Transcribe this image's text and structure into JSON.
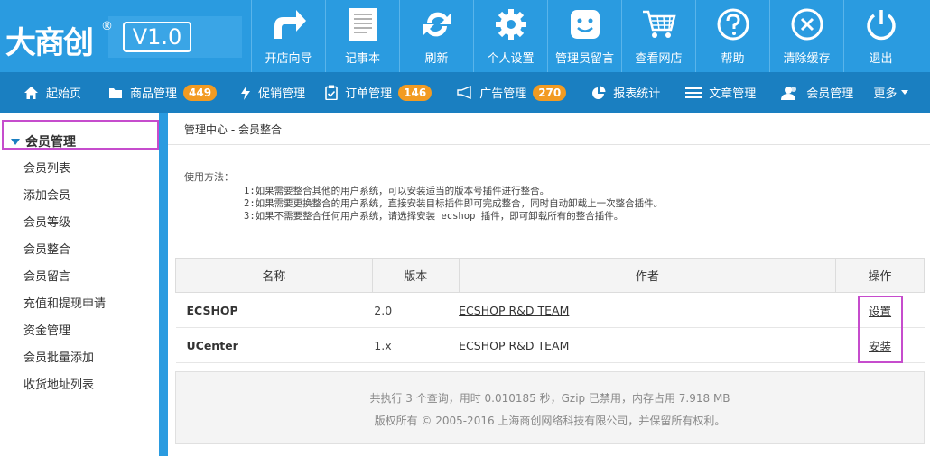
{
  "logo": {
    "brand": "大商创",
    "registered": "®",
    "version": "V1.0"
  },
  "topnav": [
    {
      "label": "开店向导",
      "icon": "redo-arrow-icon"
    },
    {
      "label": "记事本",
      "icon": "notepad-icon"
    },
    {
      "label": "刷新",
      "icon": "refresh-icon"
    },
    {
      "label": "个人设置",
      "icon": "gear-icon"
    },
    {
      "label": "管理员留言",
      "icon": "smiley-message-icon"
    },
    {
      "label": "查看网店",
      "icon": "shopping-cart-icon"
    },
    {
      "label": "帮助",
      "icon": "help-icon"
    },
    {
      "label": "清除缓存",
      "icon": "clear-cache-icon"
    },
    {
      "label": "退出",
      "icon": "power-icon"
    }
  ],
  "subnav": {
    "home": "起始页",
    "products": "商品管理",
    "products_count": "449",
    "promotions": "促销管理",
    "orders": "订单管理",
    "orders_count": "146",
    "ads": "广告管理",
    "ads_count": "270",
    "reports": "报表统计",
    "articles": "文章管理",
    "members": "会员管理",
    "more": "更多"
  },
  "sidebar": {
    "title": "会员管理",
    "items": [
      "会员列表",
      "添加会员",
      "会员等级",
      "会员整合",
      "会员留言",
      "充值和提现申请",
      "资金管理",
      "会员批量添加",
      "收货地址列表"
    ]
  },
  "breadcrumb": {
    "root": "管理中心",
    "sep": " - ",
    "current": "会员整合"
  },
  "usage": {
    "label": "使用方法：",
    "lines": [
      "1:如果需要整合其他的用户系统，可以安装适当的版本号插件进行整合。",
      "2:如果需要更换整合的用户系统，直接安装目标插件即可完成整合，同时自动卸载上一次整合插件。",
      "3:如果不需要整合任何用户系统，请选择安装 ecshop 插件，即可卸载所有的整合插件。"
    ]
  },
  "table": {
    "headers": [
      "名称",
      "版本",
      "作者",
      "操作"
    ],
    "rows": [
      {
        "name": "ECSHOP",
        "version": "2.0",
        "author": "ECSHOP R&D TEAM",
        "action": "设置"
      },
      {
        "name": "UCenter",
        "version": "1.x",
        "author": "ECSHOP R&D TEAM",
        "action": "安装"
      }
    ]
  },
  "footer": {
    "line1": "共执行 3 个查询，用时 0.010185 秒，Gzip 已禁用，内存占用 7.918 MB",
    "line2": "版权所有 © 2005-2016 上海商创网络科技有限公司，并保留所有权利。"
  }
}
